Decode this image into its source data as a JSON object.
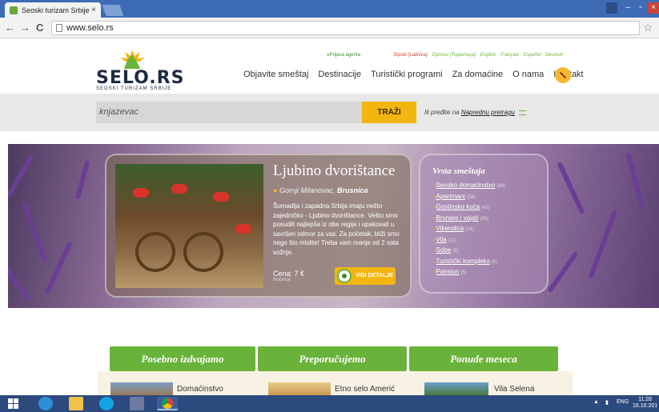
{
  "browser": {
    "tab_title": "Seoski turizam Srbije",
    "tab_close": "×",
    "url": "www.selo.rs",
    "back": "←",
    "forward": "→",
    "reload": "C",
    "star": "☆"
  },
  "header": {
    "logo_text": "SELO.RS",
    "logo_sub": "SEOSKI TURIZAM SRBIJE",
    "agent_login": "Prijava agenta",
    "languages": [
      "Srpski (Latinica)",
      "Српски (Ћирилица)",
      "English",
      "Français",
      "Español",
      "Deutsch"
    ],
    "nav": [
      "Objavite smeštaj",
      "Destinacije",
      "Turistički programi",
      "Za domaćine",
      "O nama",
      "Kontakt"
    ]
  },
  "search": {
    "value": "knjazevac",
    "button": "TRAŽI",
    "adv_prefix": "Ili pređite na",
    "adv_link": "Naprednu pretragu"
  },
  "feature": {
    "title": "Ljubino dvorištance",
    "location_prefix": "Gornji Milanovac,",
    "location_place": "Brusnica",
    "description": "Šumadija i zapadna Srbija imaju nešto zajedničko - Ljubino dvorištance. Vešto smo posudili najlepše iz obe regije i upakovali u savršen odmor za vas. Za početak, bliži smo nego što mislite! Treba vam manje od 2 sata vožnje.",
    "price": "Cena: 7 €",
    "price_note": "Noćenje",
    "details_button": "VIDI DETALJE"
  },
  "types": {
    "title": "Vrsta smeštaja",
    "items": [
      {
        "name": "Seosko domaćinstvo",
        "count": "(88)"
      },
      {
        "name": "Apartmani",
        "count": "(58)"
      },
      {
        "name": "Gostinska kuća",
        "count": "(43)"
      },
      {
        "name": "Brvnare i vajati",
        "count": "(26)"
      },
      {
        "name": "Vikendica",
        "count": "(14)"
      },
      {
        "name": "Vila",
        "count": "(11)"
      },
      {
        "name": "Sobe",
        "count": "(9)"
      },
      {
        "name": "Turistički kompleks",
        "count": "(6)"
      },
      {
        "name": "Pansion",
        "count": "(5)"
      }
    ]
  },
  "boxes": [
    {
      "title": "Posebno izdvajamo",
      "item": "Domaćinstvo"
    },
    {
      "title": "Preporučujemo",
      "item": "Etno selo Amerić"
    },
    {
      "title": "Ponude meseca",
      "item": "Vila Selena"
    }
  ],
  "taskbar": {
    "lang": "ENG",
    "time": "11:28",
    "date": "16.10.201"
  },
  "colors": {
    "brand_green": "#6ab33a",
    "accent_yellow": "#f3b510",
    "chrome_blue": "#3d6cb4",
    "taskbar": "#2d4a7e"
  }
}
